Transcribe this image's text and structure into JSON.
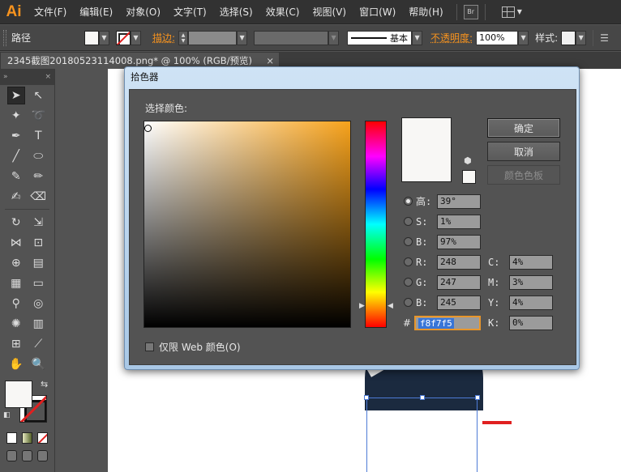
{
  "app": {
    "logo": "Ai",
    "menus": [
      "文件(F)",
      "编辑(E)",
      "对象(O)",
      "文字(T)",
      "选择(S)",
      "效果(C)",
      "视图(V)",
      "窗口(W)",
      "帮助(H)"
    ],
    "bridge_label": "Br"
  },
  "control_bar": {
    "selection_label": "路径",
    "stroke_label": "描边:",
    "line_style_label": "基本",
    "opacity_label": "不透明度:",
    "opacity_value": "100%",
    "style_label": "样式:"
  },
  "document_tab": {
    "title": "2345截图20180523114008.png* @ 100% (RGB/预览)",
    "close": "×"
  },
  "dialog": {
    "title": "拾色器",
    "select_color_label": "选择颜色:",
    "buttons": {
      "ok": "确定",
      "cancel": "取消",
      "swatches": "颜色色板"
    },
    "hsb": [
      {
        "label": "高:",
        "value": "39°"
      },
      {
        "label": "S:",
        "value": "1%"
      },
      {
        "label": "B:",
        "value": "97%"
      }
    ],
    "rgb": [
      {
        "label": "R:",
        "value": "248"
      },
      {
        "label": "G:",
        "value": "247"
      },
      {
        "label": "B:",
        "value": "245"
      }
    ],
    "cmyk": [
      {
        "label": "C:",
        "value": "4%"
      },
      {
        "label": "M:",
        "value": "3%"
      },
      {
        "label": "Y:",
        "value": "4%"
      },
      {
        "label": "K:",
        "value": "0%"
      }
    ],
    "hex_label": "#",
    "hex_value": "f8f7f5",
    "web_only_label": "仅限 Web 颜色(O)"
  },
  "colors": {
    "current_color": "#f8f7f5",
    "hue_color": "#f7a21b",
    "accent_orange": "#f7931e"
  }
}
